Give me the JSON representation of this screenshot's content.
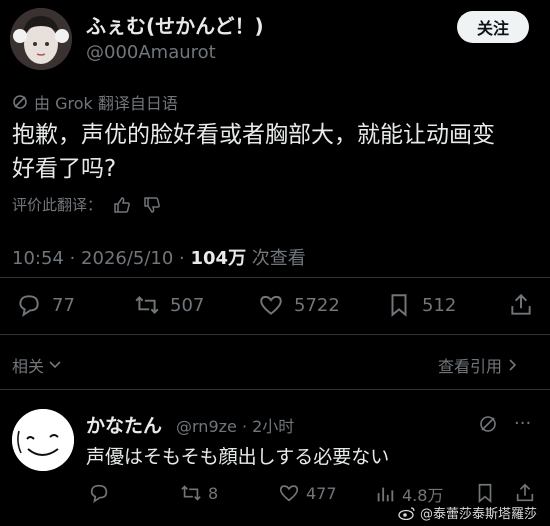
{
  "tweet": {
    "author_name": "ふぇむ(せかんど！)",
    "author_handle": "@000Amaurot",
    "follow_label": "关注",
    "translation_note": "由 Grok 翻译自日语",
    "text_line1": "抱歉，声优的脸好看或者胸部大，就能让动画变",
    "text_line2": "好看了吗?",
    "rate_translation": "评价此翻译：",
    "time_date": "10:54 · 2026/5/10 · ",
    "views_count": "104万",
    "views_label": " 次查看",
    "replies": "77",
    "retweets": "507",
    "likes": "5722",
    "bookmarks": "512"
  },
  "related_label": "相关",
  "view_quotes_label": "查看引用",
  "reply": {
    "author_name": "かなたん",
    "meta": "@rn9ze · 2小时",
    "text": "声優はそもそも顔出しする必要ない",
    "retweets": "8",
    "likes": "477",
    "views": "4.8万"
  },
  "watermark": "@泰蕾莎泰斯塔羅莎",
  "colors": {
    "background": "#000000",
    "text": "#e7e9ea",
    "muted": "#71767b",
    "button": "#eff3f4"
  }
}
